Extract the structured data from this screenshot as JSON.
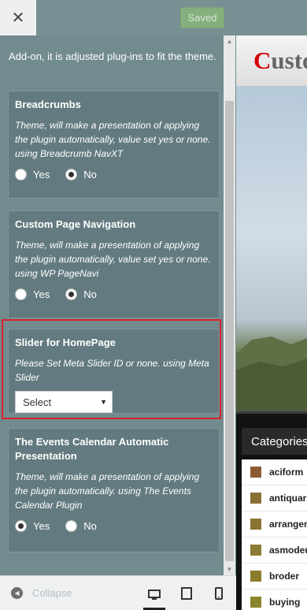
{
  "header": {
    "close_label": "✕",
    "saved_label": "Saved"
  },
  "sidebar": {
    "intro": "Add-on, it is adjusted plug-ins to fit the theme.",
    "breadcrumbs": {
      "title": "Breadcrumbs",
      "desc": "Theme, will make a presentation of applying the plugin automatically, value set yes or none. using Breadcrumb NavXT",
      "yes": "Yes",
      "no": "No",
      "selected": "No"
    },
    "page_nav": {
      "title": "Custom Page Navigation",
      "desc": "Theme, will make a presentation of applying the plugin automatically, value set yes or none. using WP PageNavi",
      "yes": "Yes",
      "no": "No",
      "selected": "No"
    },
    "slider": {
      "title": "Slider for HomePage",
      "desc": "Please Set Meta Slider ID or none. using Meta Slider",
      "select_value": "Select"
    },
    "events": {
      "title": "The Events Calendar Automatic Presentation",
      "desc": "Theme, will make a presentation of applying the plugin automatically. using The Events Calendar Plugin",
      "yes": "Yes",
      "no": "No",
      "selected": "Yes"
    }
  },
  "footer": {
    "collapse_label": "Collapse",
    "devices": [
      "desktop-icon",
      "tablet-icon",
      "mobile-icon"
    ],
    "active_device": "desktop"
  },
  "preview": {
    "title_first": "C",
    "title_rest": "usto",
    "categories_label": "Categories",
    "categories": [
      {
        "label": "aciform",
        "color": "#8a5a34"
      },
      {
        "label": "antiquarian",
        "color": "#8a6f34"
      },
      {
        "label": "arrangement",
        "color": "#8a7434"
      },
      {
        "label": "asmodeus",
        "color": "#8a7c34"
      },
      {
        "label": "broder",
        "color": "#8a7c2c"
      },
      {
        "label": "buying",
        "color": "#8a852c"
      }
    ]
  }
}
